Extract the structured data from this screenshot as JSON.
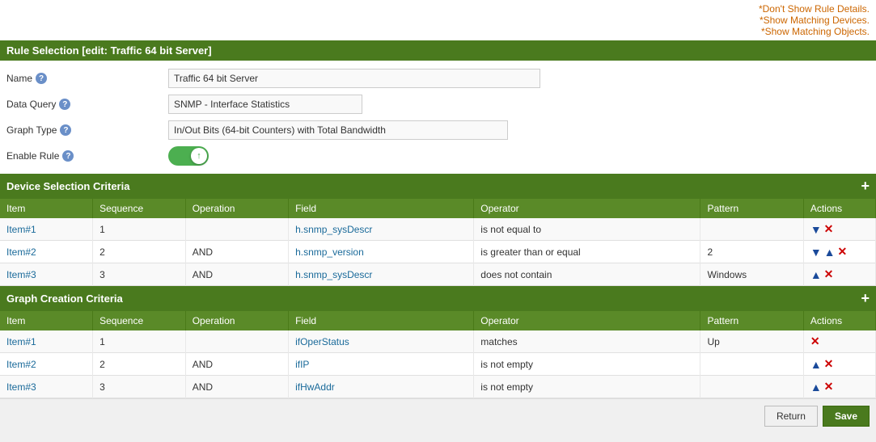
{
  "topLinks": {
    "link1": "*Don't Show Rule Details.",
    "link2": "*Show Matching Devices.",
    "link3": "*Show Matching Objects."
  },
  "ruleSelection": {
    "header": "Rule Selection [edit: Traffic 64 bit Server]",
    "nameLabel": "Name",
    "nameValue": "Traffic 64 bit Server",
    "dataQueryLabel": "Data Query",
    "dataQueryValue": "SNMP - Interface Statistics",
    "graphTypeLabel": "Graph Type",
    "graphTypeValue": "In/Out Bits (64-bit Counters) with Total Bandwidth",
    "enableRuleLabel": "Enable Rule"
  },
  "deviceSelectionCriteria": {
    "header": "Device Selection Criteria",
    "columns": [
      "Item",
      "Sequence",
      "Operation",
      "Field",
      "Operator",
      "Pattern",
      "Actions"
    ],
    "rows": [
      {
        "item": "Item#1",
        "sequence": "1",
        "operation": "",
        "field": "h.snmp_sysDescr",
        "operator": "is not equal to",
        "pattern": "",
        "hasDown": true,
        "hasUp": false
      },
      {
        "item": "Item#2",
        "sequence": "2",
        "operation": "AND",
        "field": "h.snmp_version",
        "operator": "is greater than or equal",
        "pattern": "2",
        "hasDown": true,
        "hasUp": true
      },
      {
        "item": "Item#3",
        "sequence": "3",
        "operation": "AND",
        "field": "h.snmp_sysDescr",
        "operator": "does not contain",
        "pattern": "Windows",
        "hasDown": false,
        "hasUp": true
      }
    ]
  },
  "graphCreationCriteria": {
    "header": "Graph Creation Criteria",
    "columns": [
      "Item",
      "Sequence",
      "Operation",
      "Field",
      "Operator",
      "Pattern",
      "Actions"
    ],
    "rows": [
      {
        "item": "Item#1",
        "sequence": "1",
        "operation": "",
        "field": "ifOperStatus",
        "operator": "matches",
        "pattern": "Up",
        "hasDown": false,
        "hasUp": false
      },
      {
        "item": "Item#2",
        "sequence": "2",
        "operation": "AND",
        "field": "ifIP",
        "operator": "is not empty",
        "pattern": "",
        "hasDown": false,
        "hasUp": true
      },
      {
        "item": "Item#3",
        "sequence": "3",
        "operation": "AND",
        "field": "ifHwAddr",
        "operator": "is not empty",
        "pattern": "",
        "hasDown": false,
        "hasUp": true
      }
    ]
  },
  "buttons": {
    "return": "Return",
    "save": "Save"
  }
}
